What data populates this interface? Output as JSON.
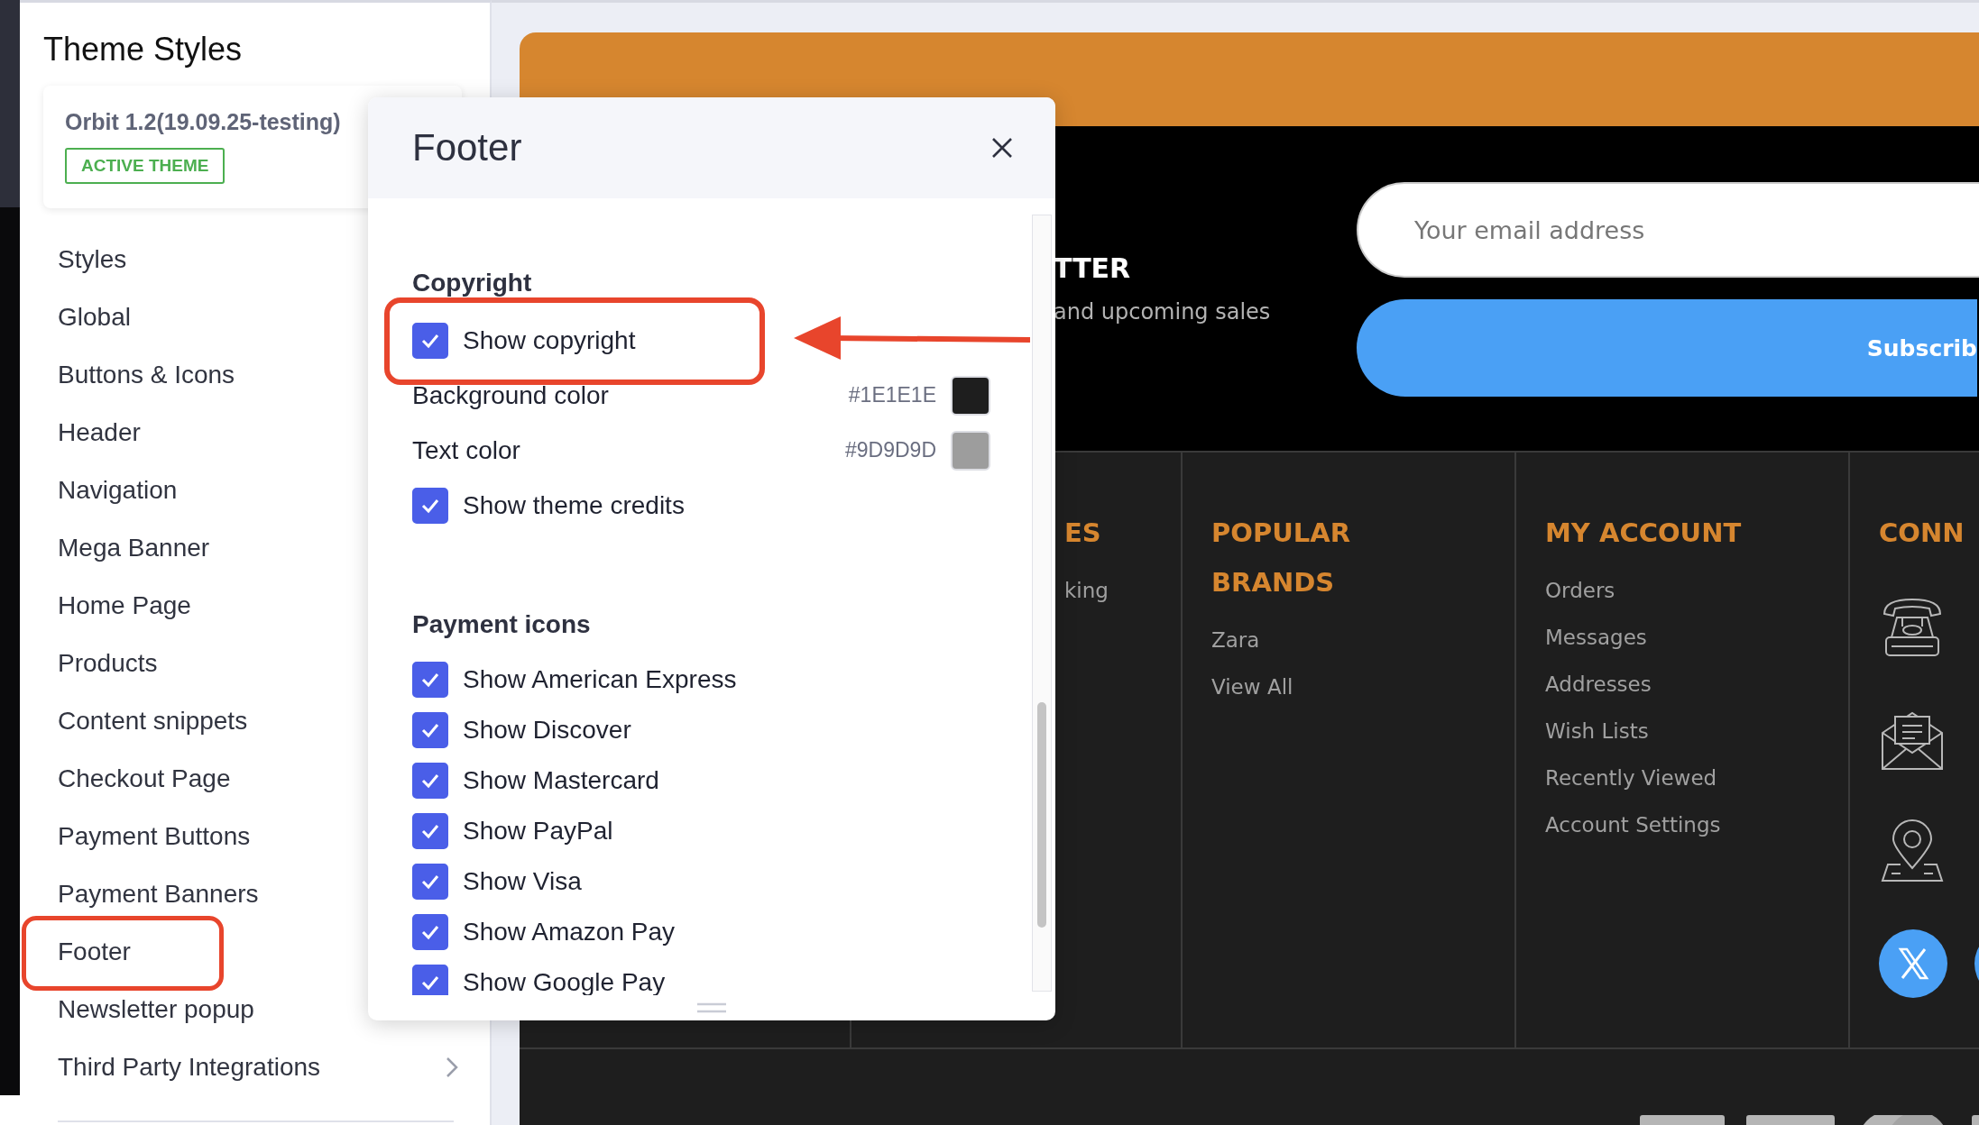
{
  "sidebar": {
    "title": "Theme Styles",
    "theme_card": {
      "name": "Orbit 1.2(19.09.25-testing)",
      "badge": "ACTIVE THEME"
    },
    "items": [
      {
        "label": "Styles",
        "highlighted": false,
        "has_submenu": false
      },
      {
        "label": "Global",
        "highlighted": false,
        "has_submenu": false
      },
      {
        "label": "Buttons & Icons",
        "highlighted": false,
        "has_submenu": false
      },
      {
        "label": "Header",
        "highlighted": false,
        "has_submenu": false
      },
      {
        "label": "Navigation",
        "highlighted": false,
        "has_submenu": false
      },
      {
        "label": "Mega Banner",
        "highlighted": false,
        "has_submenu": false
      },
      {
        "label": "Home Page",
        "highlighted": false,
        "has_submenu": false
      },
      {
        "label": "Products",
        "highlighted": false,
        "has_submenu": false
      },
      {
        "label": "Content snippets",
        "highlighted": false,
        "has_submenu": false
      },
      {
        "label": "Checkout Page",
        "highlighted": false,
        "has_submenu": false
      },
      {
        "label": "Payment Buttons",
        "highlighted": false,
        "has_submenu": false
      },
      {
        "label": "Payment Banners",
        "highlighted": false,
        "has_submenu": false
      },
      {
        "label": "Footer",
        "highlighted": true,
        "has_submenu": false
      },
      {
        "label": "Newsletter popup",
        "highlighted": false,
        "has_submenu": false
      },
      {
        "label": "Third Party Integrations",
        "highlighted": false,
        "has_submenu": true
      }
    ]
  },
  "preview": {
    "newsletter": {
      "heading": "TTER",
      "text": "and upcoming sales",
      "email_placeholder": "Your email address",
      "button": "Subscrib"
    },
    "columns": [
      {
        "kind": "links",
        "heading": "ES",
        "links": [
          "king"
        ]
      },
      {
        "kind": "links",
        "heading": "POPULAR BRANDS",
        "links": [
          "Zara",
          "View All"
        ]
      },
      {
        "kind": "links",
        "heading": "MY ACCOUNT",
        "links": [
          "Orders",
          "Messages",
          "Addresses",
          "Wish Lists",
          "Recently Viewed",
          "Account Settings"
        ]
      },
      {
        "kind": "contact",
        "heading": "CONN"
      }
    ]
  },
  "panel": {
    "title": "Footer",
    "sections": [
      {
        "heading": "Copyright",
        "rows": [
          {
            "kind": "checkbox",
            "label": "Show copyright",
            "checked": true,
            "highlighted": true
          },
          {
            "kind": "color",
            "label": "Background color",
            "value": "#1E1E1E",
            "color": "#1e1e1e"
          },
          {
            "kind": "color",
            "label": "Text color",
            "value": "#9D9D9D",
            "color": "#9d9d9d"
          },
          {
            "kind": "checkbox",
            "label": "Show theme credits",
            "checked": true,
            "highlighted": false
          }
        ]
      },
      {
        "heading": "Payment icons",
        "rows": [
          {
            "kind": "checkbox",
            "label": "Show American Express",
            "checked": true,
            "highlighted": false
          },
          {
            "kind": "checkbox",
            "label": "Show Discover",
            "checked": true,
            "highlighted": false
          },
          {
            "kind": "checkbox",
            "label": "Show Mastercard",
            "checked": true,
            "highlighted": false
          },
          {
            "kind": "checkbox",
            "label": "Show PayPal",
            "checked": true,
            "highlighted": false
          },
          {
            "kind": "checkbox",
            "label": "Show Visa",
            "checked": true,
            "highlighted": false
          },
          {
            "kind": "checkbox",
            "label": "Show Amazon Pay",
            "checked": true,
            "highlighted": false
          },
          {
            "kind": "checkbox",
            "label": "Show Google Pay",
            "checked": true,
            "highlighted": false
          }
        ]
      }
    ]
  }
}
